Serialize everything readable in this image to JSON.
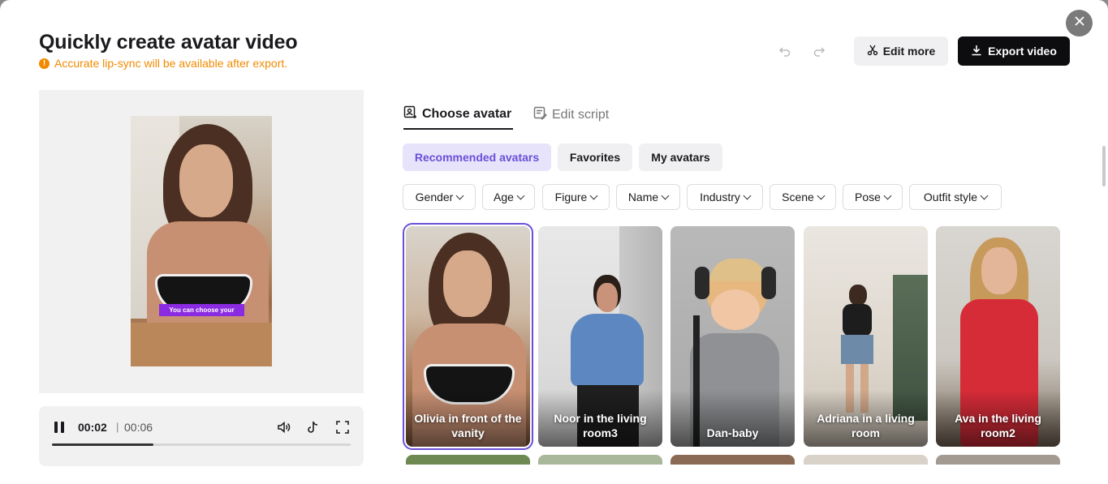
{
  "header": {
    "title": "Quickly create avatar video",
    "warning": "Accurate lip-sync will be available after export.",
    "edit_more": "Edit more",
    "export_video": "Export video"
  },
  "preview": {
    "caption": "You can choose your"
  },
  "player": {
    "current_time": "00:02",
    "separator": "|",
    "total_time": "00:06",
    "progress": 0.34
  },
  "tabs": [
    {
      "label": "Choose avatar"
    },
    {
      "label": "Edit script"
    }
  ],
  "categories": [
    {
      "label": "Recommended avatars"
    },
    {
      "label": "Favorites"
    },
    {
      "label": "My avatars"
    }
  ],
  "filters": [
    {
      "label": "Gender"
    },
    {
      "label": "Age"
    },
    {
      "label": "Figure"
    },
    {
      "label": "Name"
    },
    {
      "label": "Industry"
    },
    {
      "label": "Scene"
    },
    {
      "label": "Pose"
    },
    {
      "label": "Outfit style"
    }
  ],
  "avatars": [
    {
      "label": "Olivia in front of the vanity"
    },
    {
      "label": "Noor in the living room3"
    },
    {
      "label": "Dan-baby"
    },
    {
      "label": "Adriana in a living room"
    },
    {
      "label": "Ava in the living room2"
    }
  ],
  "colors": {
    "accent": "#6b4fd8",
    "warning": "#f28a00",
    "export_bg": "#0d0d10",
    "caption_bg": "#8a2be2"
  }
}
